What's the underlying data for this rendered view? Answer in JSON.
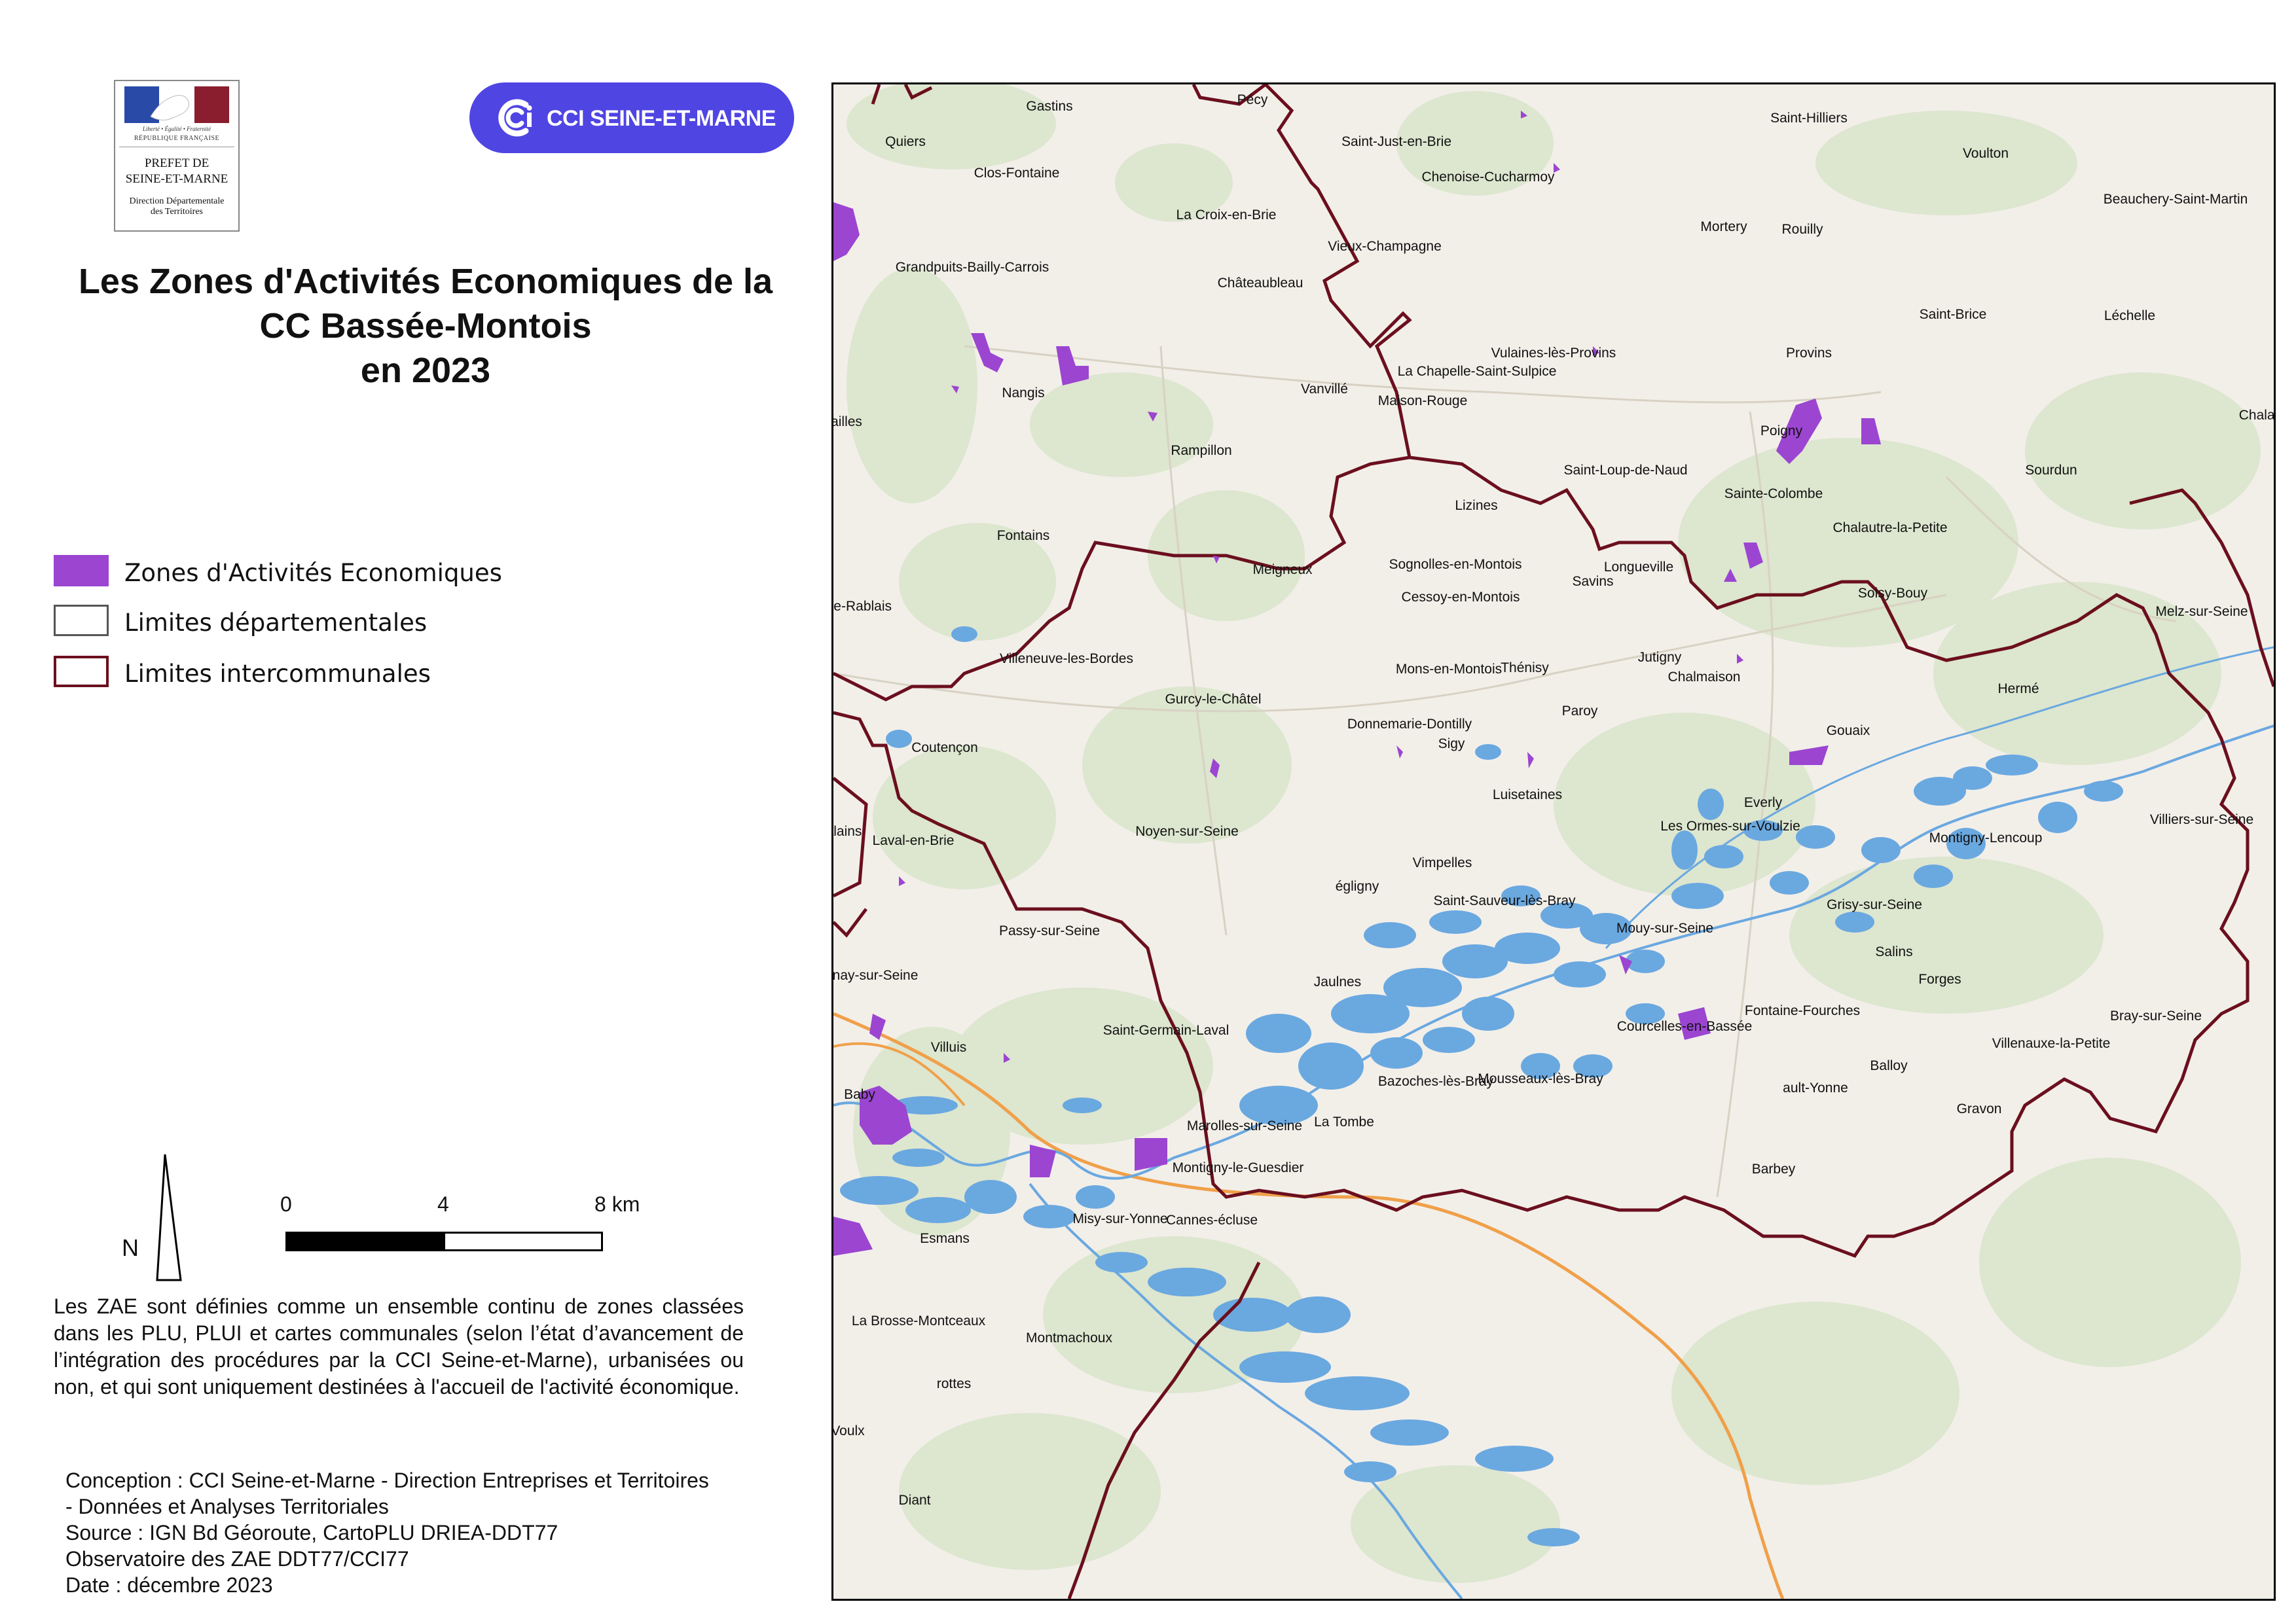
{
  "prefet": {
    "motto": "Liberté • Égalité • Fraternité",
    "republique": "RÉPUBLIQUE FRANÇAISE",
    "line1": "PREFET DE",
    "line2": "SEINE-ET-MARNE",
    "ddt1": "Direction Départementale",
    "ddt2": "des Territoires"
  },
  "cci": {
    "label": "CCI SEINE-ET-MARNE",
    "color": "#4f45e3"
  },
  "title": {
    "line1": "Les Zones d'Activités Economiques de la",
    "line2": "CC Bassée-Montois",
    "line3": "en 2023"
  },
  "legend": [
    {
      "label": "Zones d'Activités Economiques",
      "fill": "#9b45d1",
      "stroke": "#9b45d1"
    },
    {
      "label": "Limites départementales",
      "fill": "#ffffff",
      "stroke": "#555555"
    },
    {
      "label": "Limites intercommunales",
      "fill": "#ffffff",
      "stroke": "#6b0f1e"
    }
  ],
  "north": {
    "label": "N"
  },
  "scale": {
    "ticks": [
      "0",
      "4",
      "8 km"
    ]
  },
  "description": "Les ZAE sont définies comme un ensemble continu de zones classées dans les PLU, PLUI et cartes communales (selon l’état d’avancement de l’intégration des procédures par la CCI Seine-et-Marne), urbanisées ou non, et qui sont uniquement destinées à l'accueil de l'activité économique.",
  "credits": {
    "line1": "Conception : CCI Seine-et-Marne - Direction Entreprises et Territoires",
    "line2": "- Données et Analyses Territoriales",
    "line3": "Source : IGN Bd Géoroute, CartoPLU DRIEA-DDT77",
    "line4": "Observatoire des ZAE DDT77/CCI77",
    "line5": "Date : décembre 2023"
  },
  "map": {
    "colors": {
      "background": "#f2efe9",
      "forest": "#dde6cf",
      "water": "#6aa8e0",
      "zae": "#9b45d1",
      "boundary": "#6b0f1e",
      "road_main": "#f0a04a"
    },
    "places": [
      "Gastins",
      "Pécy",
      "Quiers",
      "Saint-Just-en-Brie",
      "Saint-Hilliers",
      "Voulton",
      "Clos-Fontaine",
      "Chenoise-Cucharmoy",
      "Beauchery-Saint-Martin",
      "La Croix-en-Brie",
      "Mortery",
      "Rouilly",
      "Vieux-Champagne",
      "Grandpuits-Bailly-Carrois",
      "Châteaubleau",
      "Saint-Brice",
      "Léchelle",
      "Provins",
      "Vulaines-lès-Provins",
      "La Chapelle-Saint-Sulpice",
      "Nangis",
      "Vanvillé",
      "Maison-Rouge",
      "Chalau",
      "ailles",
      "Poigny",
      "Rampillon",
      "Saint-Loup-de-Naud",
      "Sourdun",
      "Sainte-Colombe",
      "Lizines",
      "Chalautre-la-Petite",
      "Fontains",
      "Longueville",
      "Meigneux",
      "Sognolles-en-Montois",
      "Savins",
      "Cessoy-en-Montois",
      "Soisy-Bouy",
      "lle-Rablais",
      "Melz-sur-Seine",
      "Jutigny",
      "Villeneuve-les-Bordes",
      "Mons-en-Montois",
      "Thénisy",
      "Chalmaison",
      "Hermé",
      "Gurcy-le-Châtel",
      "Paroy",
      "Donnemarie-Dontilly",
      "Gouaix",
      "Sigy",
      "Coutençon",
      "Luisetaines",
      "Everly",
      "Villiers-sur-Seine",
      "Les Ormes-sur-Voulzie",
      "Montigny-Lencoup",
      "Noyen-sur-Seine",
      "alains",
      "Laval-en-Brie",
      "Vimpelles",
      "égligny",
      "Saint-Sauveur-lès-Bray",
      "Grisy-sur-Seine",
      "Mouy-sur-Seine",
      "Salins",
      "Passy-sur-Seine",
      "Forges",
      "Châtenay-sur-Seine",
      "Jaulnes",
      "Fontaine-Fourches",
      "Bray-sur-Seine",
      "Courcelles-en-Bassée",
      "Saint-Germain-Laval",
      "Villuis",
      "Villenauxe-la-Petite",
      "Balloy",
      "Bazoches-lès-Bray",
      "Mousseaux-lès-Bray",
      "ault-Yonne",
      "Baby",
      "Gravon",
      "La Tombe",
      "Marolles-sur-Seine",
      "Montigny-le-Guesdier",
      "Barbey",
      "Misy-sur-Yonne",
      "Cannes-écluse",
      "Esmans",
      "La Brosse-Montceaux",
      "Montmachoux",
      "rottes",
      "Voulx",
      "Diant"
    ]
  }
}
